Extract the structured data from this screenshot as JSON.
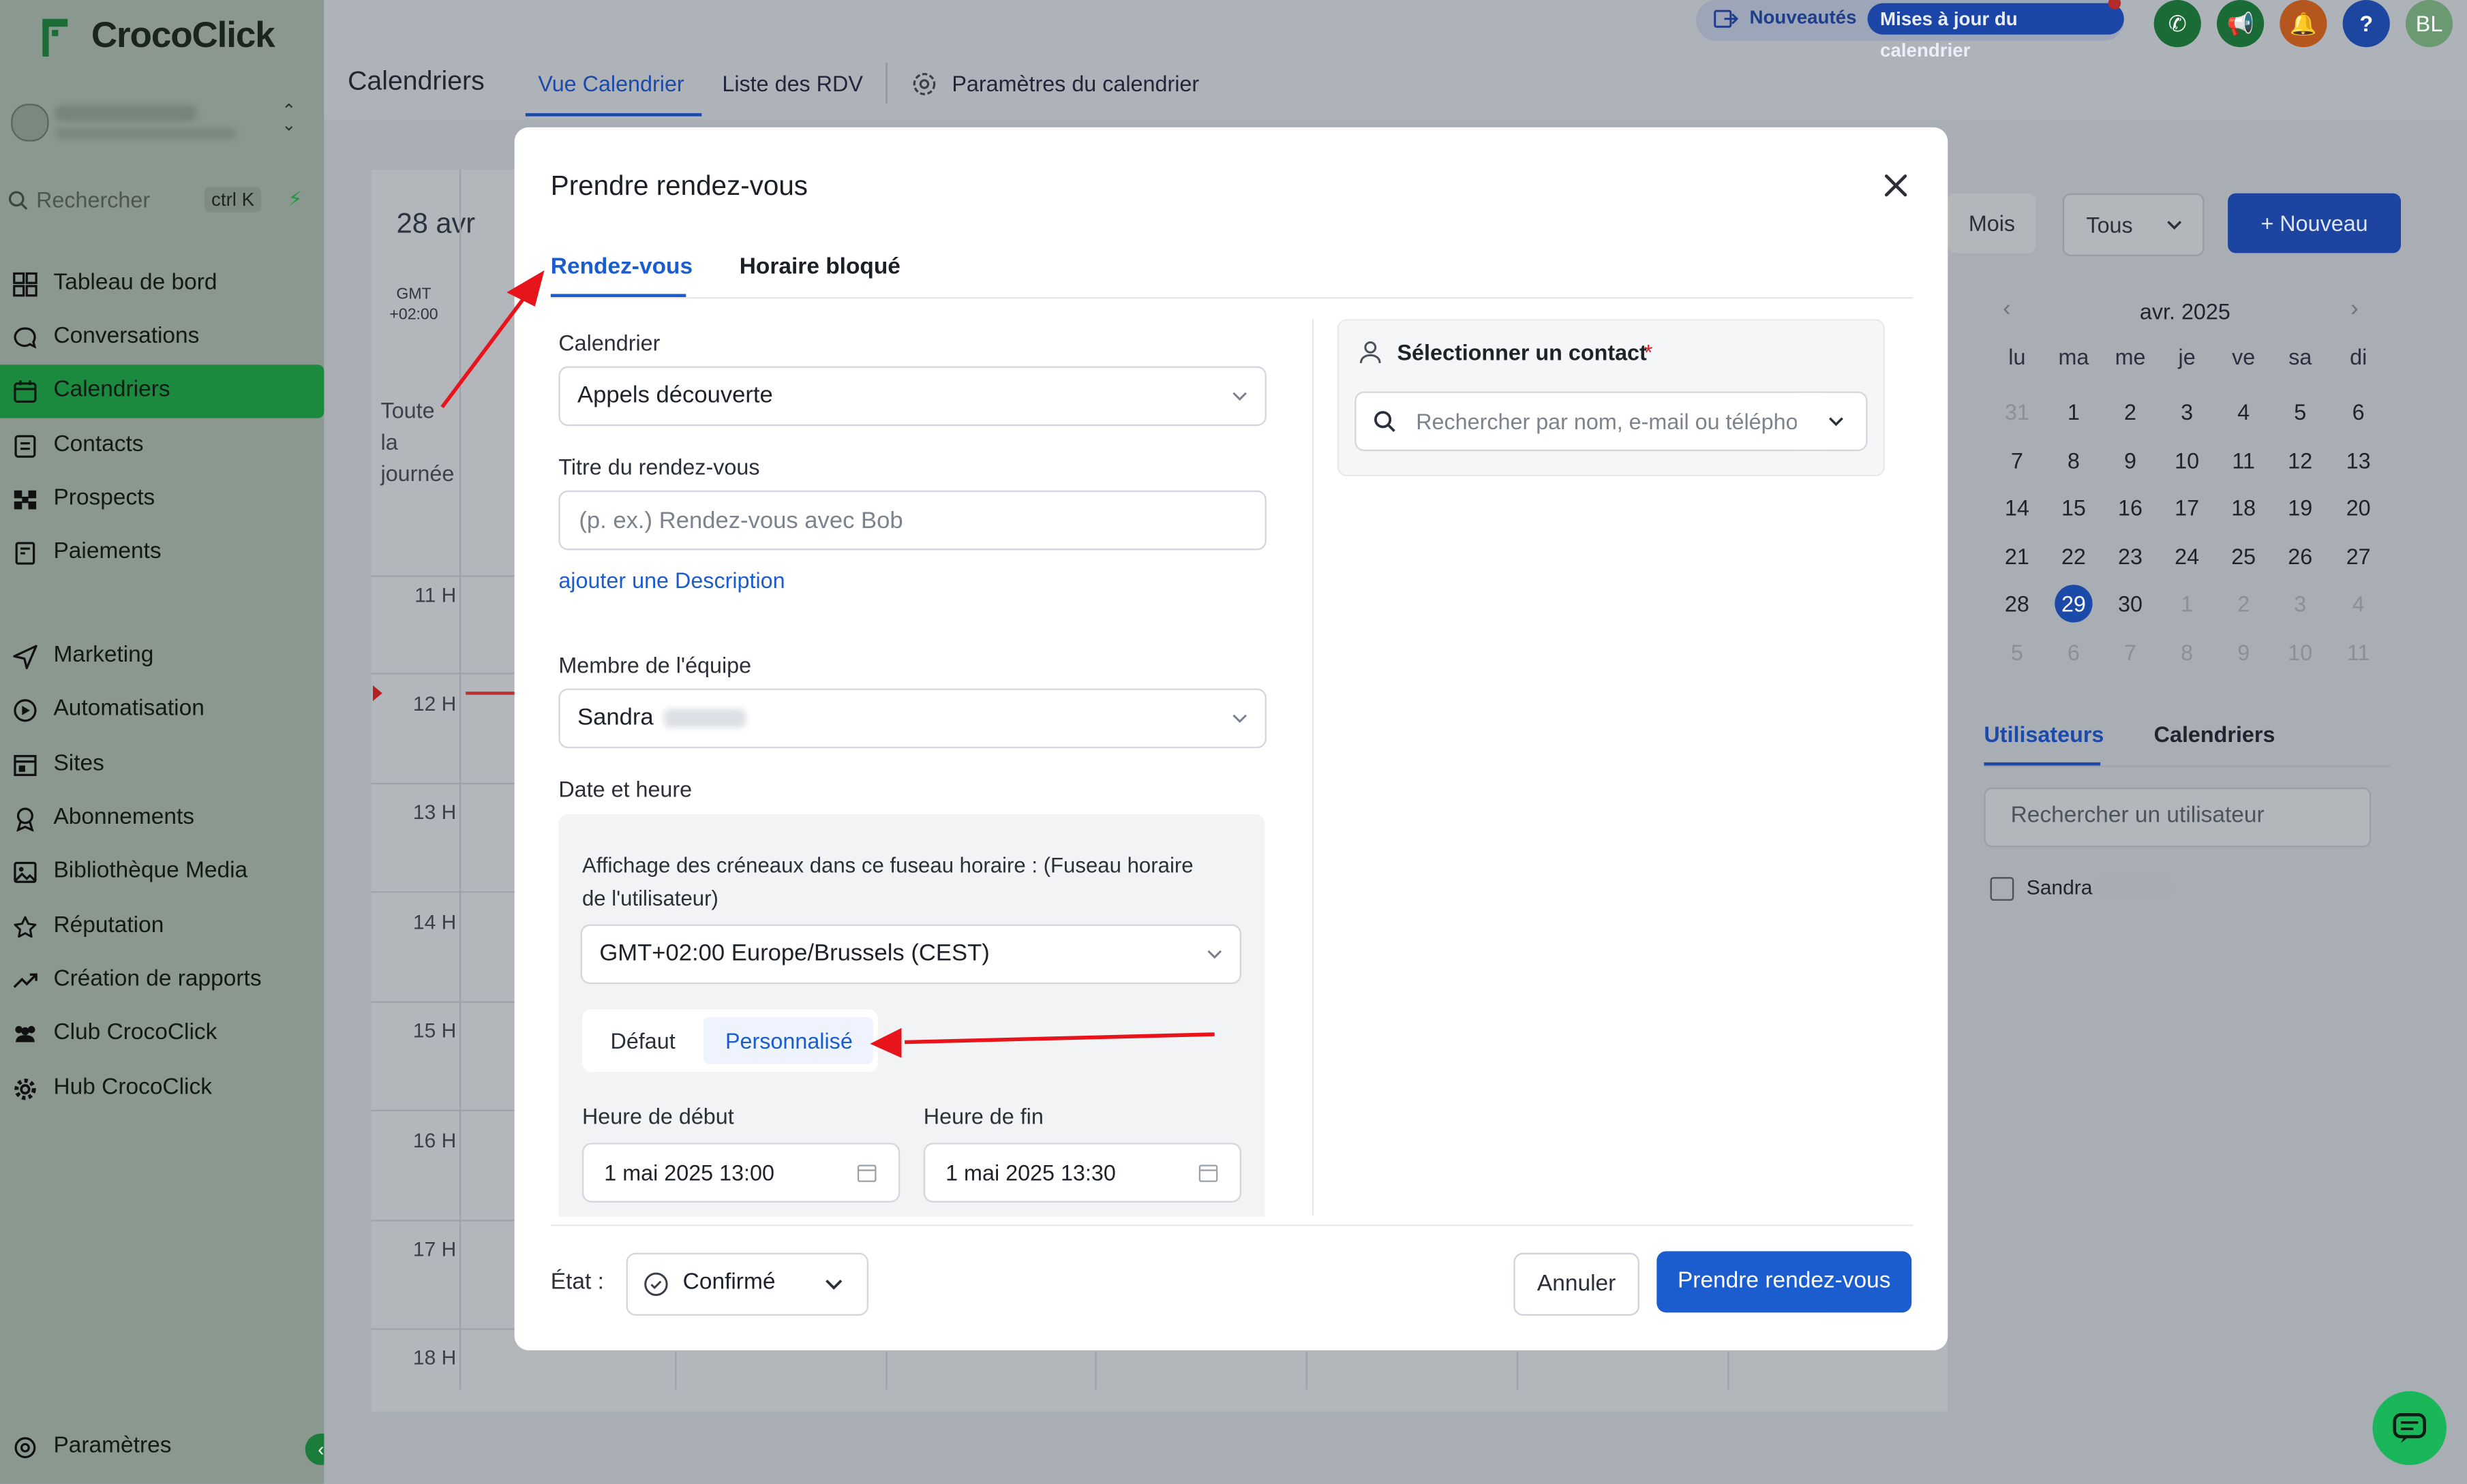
{
  "app": {
    "brand": "CrocoClick"
  },
  "sidebar": {
    "search_placeholder": "Rechercher",
    "search_shortcut": "ctrl K",
    "items": [
      {
        "label": "Tableau de bord",
        "icon": "dashboard-icon"
      },
      {
        "label": "Conversations",
        "icon": "chat-icon"
      },
      {
        "label": "Calendriers",
        "icon": "calendar-icon",
        "active": true
      },
      {
        "label": "Contacts",
        "icon": "contacts-icon"
      },
      {
        "label": "Prospects",
        "icon": "pipeline-icon"
      },
      {
        "label": "Paiements",
        "icon": "receipt-icon"
      },
      {
        "label": "Marketing",
        "icon": "send-icon"
      },
      {
        "label": "Automatisation",
        "icon": "automation-icon"
      },
      {
        "label": "Sites",
        "icon": "sites-icon"
      },
      {
        "label": "Abonnements",
        "icon": "badge-icon"
      },
      {
        "label": "Bibliothèque Media",
        "icon": "image-icon"
      },
      {
        "label": "Réputation",
        "icon": "star-icon"
      },
      {
        "label": "Création de rapports",
        "icon": "trend-icon"
      },
      {
        "label": "Club CrocoClick",
        "icon": "users-icon"
      },
      {
        "label": "Hub CrocoClick",
        "icon": "gear-icon"
      }
    ],
    "settings_label": "Paramètres"
  },
  "header": {
    "title": "Calendriers",
    "tabs": [
      "Vue Calendrier",
      "Liste des RDV",
      "Paramètres du calendrier"
    ],
    "news_label": "Nouveautés",
    "news_badge": "Mises à jour du calendrier",
    "avatar_initials": "BL",
    "help_glyph": "?"
  },
  "calendar": {
    "date_label": "28 avr",
    "gmt_label": "GMT +02:00",
    "all_day_lines": [
      "Toute",
      "la",
      "journée"
    ],
    "hours": [
      "11 H",
      "12 H",
      "13 H",
      "14 H",
      "15 H",
      "16 H",
      "17 H",
      "18 H"
    ]
  },
  "right_panel": {
    "view_button": "Mois",
    "filter_select": "Tous",
    "new_button": "+ Nouveau",
    "month_title": "avr. 2025",
    "weekdays": [
      "lu",
      "ma",
      "me",
      "je",
      "ve",
      "sa",
      "di"
    ],
    "weeks": [
      [
        "31",
        "1",
        "2",
        "3",
        "4",
        "5",
        "6"
      ],
      [
        "7",
        "8",
        "9",
        "10",
        "11",
        "12",
        "13"
      ],
      [
        "14",
        "15",
        "16",
        "17",
        "18",
        "19",
        "20"
      ],
      [
        "21",
        "22",
        "23",
        "24",
        "25",
        "26",
        "27"
      ],
      [
        "28",
        "29",
        "30",
        "1",
        "2",
        "3",
        "4"
      ],
      [
        "5",
        "6",
        "7",
        "8",
        "9",
        "10",
        "11"
      ]
    ],
    "today": "29",
    "tabs": [
      "Utilisateurs",
      "Calendriers"
    ],
    "user_search_placeholder": "Rechercher un utilisateur",
    "user_name": "Sandra"
  },
  "modal": {
    "title": "Prendre rendez-vous",
    "tabs": [
      "Rendez-vous",
      "Horaire bloqué"
    ],
    "calendar_label": "Calendrier",
    "calendar_value": "Appels découverte",
    "title_label": "Titre du rendez-vous",
    "title_placeholder": "(p. ex.) Rendez-vous avec Bob",
    "add_description": "ajouter une Description",
    "member_label": "Membre de l'équipe",
    "member_value": "Sandra",
    "datetime_label": "Date et heure",
    "tz_line1": "Affichage des créneaux dans ce fuseau horaire : (Fuseau horaire",
    "tz_line2": "de l'utilisateur)",
    "tz_value": "GMT+02:00 Europe/Brussels (CEST)",
    "mode_default": "Défaut",
    "mode_custom": "Personnalisé",
    "start_label": "Heure de début",
    "start_value": "1 mai 2025 13:00",
    "end_label": "Heure de fin",
    "end_value": "1 mai 2025 13:30",
    "contact_label": "Sélectionner un contact",
    "contact_required": "*",
    "contact_placeholder": "Rechercher par nom, e-mail ou téléphone",
    "status_label": "État :",
    "status_value": "Confirmé",
    "cancel_button": "Annuler",
    "submit_button": "Prendre rendez-vous"
  },
  "colors": {
    "primary": "#1b5ccf",
    "annotation": "#e8141b",
    "brand_green": "#1b8a3e"
  }
}
